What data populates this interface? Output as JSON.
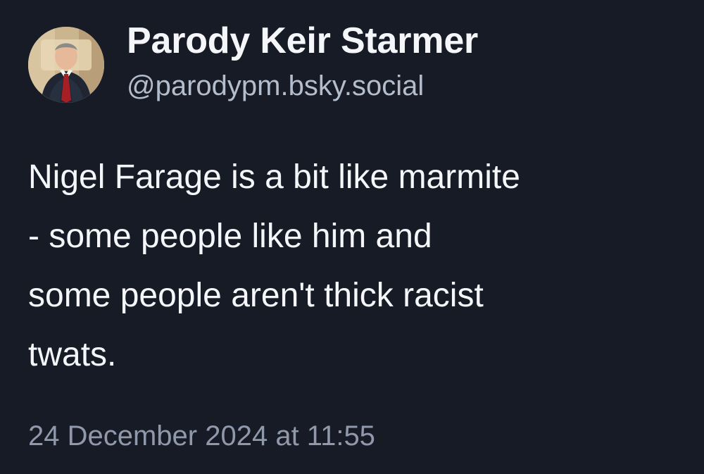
{
  "post": {
    "author": {
      "display_name": "Parody Keir Starmer",
      "handle": "@parodypm.bsky.social",
      "avatar_icon": "profile-photo"
    },
    "text_lines": [
      "Nigel Farage is a bit like marmite",
      "- some people like him and",
      "some people aren't thick racist",
      "twats."
    ],
    "timestamp": "24 December 2024 at 11:55"
  },
  "colors": {
    "background": "#171b25",
    "primary_text": "#f4f6fa",
    "handle_text": "#b3bdcc",
    "timestamp_text": "#8f99ab"
  }
}
